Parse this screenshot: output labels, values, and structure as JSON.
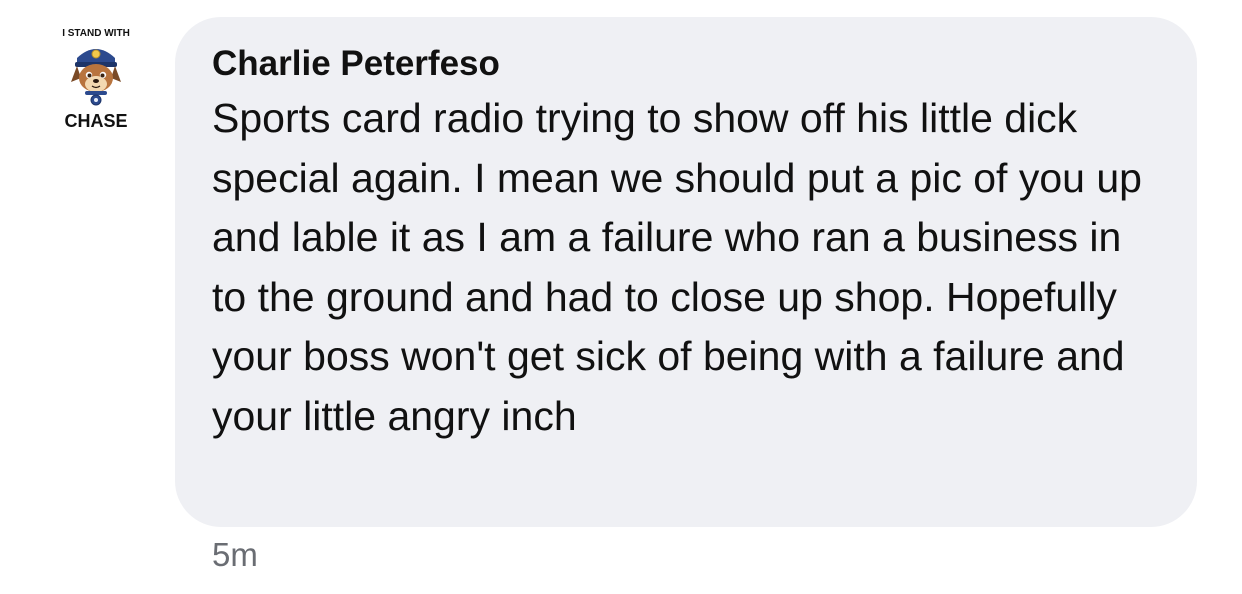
{
  "avatar": {
    "top_text": "I STAND WITH",
    "bottom_text": "CHASE",
    "icon": "chase-dog-icon"
  },
  "comment": {
    "author": "Charlie Peterfeso",
    "text": "Sports card radio trying to show off his little dick special again. I mean we should put a pic of you up and lable it as I am a failure who ran a business in to the ground and had to close up shop. Hopefully your boss won't get sick of being with a failure and your little angry inch",
    "timestamp": "5m"
  },
  "colors": {
    "bubble": "#eff0f4",
    "text": "#111111",
    "timestamp": "#6a6d73",
    "badge_blue": "#2c4a8e"
  }
}
